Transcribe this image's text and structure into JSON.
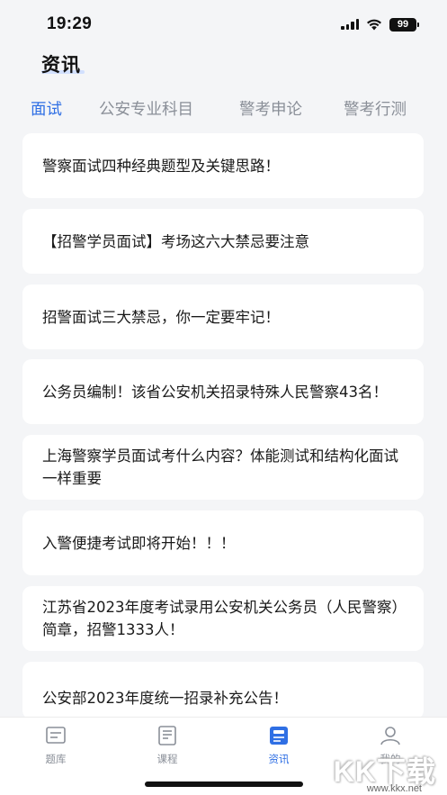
{
  "status_bar": {
    "time": "19:29",
    "battery": "99"
  },
  "header": {
    "title": "资讯"
  },
  "tabs": [
    {
      "label": "面试",
      "active": true
    },
    {
      "label": "公安专业科目",
      "active": false
    },
    {
      "label": "警考申论",
      "active": false
    },
    {
      "label": "警考行测",
      "active": false
    }
  ],
  "articles": [
    {
      "title": "警察面试四种经典题型及关键思路！"
    },
    {
      "title": "【招警学员面试】考场这六大禁忌要注意"
    },
    {
      "title": "招警面试三大禁忌，你一定要牢记！"
    },
    {
      "title": "公务员编制！该省公安机关招录特殊人民警察43名！"
    },
    {
      "title": "上海警察学员面试考什么内容？体能测试和结构化面试一样重要"
    },
    {
      "title": "入警便捷考试即将开始！！！"
    },
    {
      "title": "江苏省2023年度考试录用公安机关公务员（人民警察）简章，招警1333人！"
    },
    {
      "title": "公安部2023年度统一招录补充公告！"
    }
  ],
  "bottom_nav": [
    {
      "label": "题库",
      "icon": "question-bank-icon",
      "active": false
    },
    {
      "label": "课程",
      "icon": "course-icon",
      "active": false
    },
    {
      "label": "资讯",
      "icon": "news-icon",
      "active": true
    },
    {
      "label": "我的",
      "icon": "profile-icon",
      "active": false
    }
  ],
  "watermark": {
    "text": "KK下载",
    "url": "www.kkx.net"
  },
  "colors": {
    "accent": "#2f6fe4",
    "inactive": "#8a8f98",
    "background": "#f4f5f7"
  }
}
